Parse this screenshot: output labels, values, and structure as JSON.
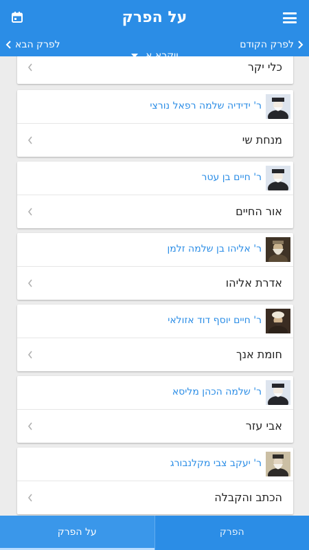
{
  "header": {
    "title": "על הפרק",
    "prev_label": "לפרק הקודם",
    "book_select": "ויקרא א",
    "next_label": "לפרק הבא"
  },
  "cards": [
    {
      "book": "כלי יקר"
    },
    {
      "author": "ר' ידידיה שלמה רפאל נורצי",
      "book": "מנחת שי"
    },
    {
      "author": "ר' חיים בן עטר",
      "book": "אור החיים"
    },
    {
      "author": "ר' אליהו בן שלמה זלמן",
      "book": "אדרת אליהו"
    },
    {
      "author": "ר' חיים יוסף דוד אזולאי",
      "book": "חומת אנך"
    },
    {
      "author": "ר' שלמה הכהן מליסא",
      "book": "אבי עזר"
    },
    {
      "author": "ר' יעקב צבי מקלנבורג",
      "book": "הכתב והקבלה"
    }
  ],
  "tabs": {
    "left": "על הפרק",
    "right": "הפרק"
  },
  "colors": {
    "accent": "#2b8de6",
    "link": "#2b8de6"
  }
}
